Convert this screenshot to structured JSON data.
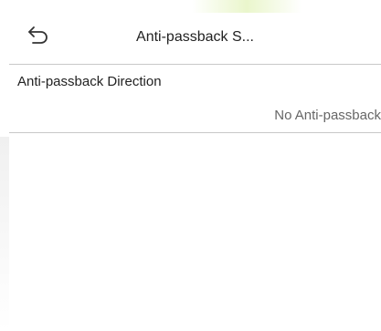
{
  "header": {
    "back_icon": "back-arrow-icon",
    "title": "Anti-passback S..."
  },
  "settings": {
    "items": [
      {
        "label": "Anti-passback Direction",
        "value": "No Anti-passback"
      }
    ]
  },
  "colors": {
    "background": "#ffffff",
    "divider": "#c8c8c8",
    "text_primary": "#222222",
    "text_secondary": "#666666"
  }
}
